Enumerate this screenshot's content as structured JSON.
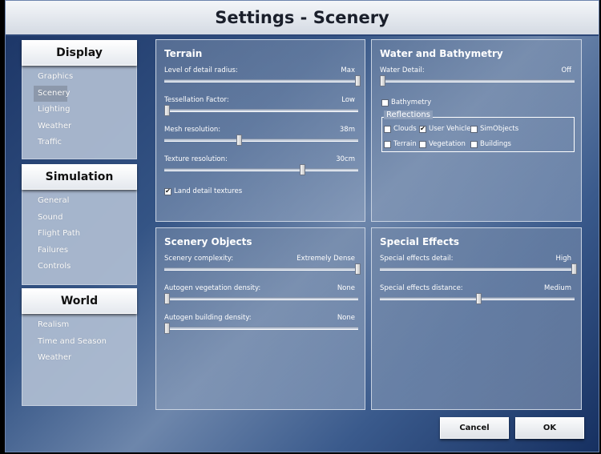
{
  "window": {
    "title": "Settings - Scenery"
  },
  "sidebar": {
    "sections": [
      {
        "header": "Display",
        "items": [
          "Graphics",
          "Scenery",
          "Lighting",
          "Weather",
          "Traffic"
        ],
        "selected": "Scenery"
      },
      {
        "header": "Simulation",
        "items": [
          "General",
          "Sound",
          "Flight Path",
          "Failures",
          "Controls"
        ]
      },
      {
        "header": "World",
        "items": [
          "Realism",
          "Time and Season",
          "Weather"
        ]
      }
    ]
  },
  "terrain": {
    "title": "Terrain",
    "lod": {
      "label": "Level of detail radius:",
      "value": "Max",
      "level": 1.0
    },
    "tess": {
      "label": "Tessellation Factor:",
      "value": "Low",
      "level": 0.0
    },
    "mesh": {
      "label": "Mesh resolution:",
      "value": "38m",
      "level": 0.38
    },
    "texture": {
      "label": "Texture resolution:",
      "value": "30cm",
      "level": 0.71
    },
    "land_detail": {
      "label": "Land detail textures",
      "checked": true
    }
  },
  "water": {
    "title": "Water and Bathymetry",
    "detail": {
      "label": "Water Detail:",
      "value": "Off",
      "level": 0.0
    },
    "bathymetry": {
      "label": "Bathymetry",
      "checked": false
    },
    "reflections": {
      "title": "Reflections",
      "clouds": {
        "label": "Clouds",
        "checked": false
      },
      "user_vehicle": {
        "label": "User Vehicle",
        "checked": true
      },
      "simobjects": {
        "label": "SimObjects",
        "checked": false
      },
      "terrain": {
        "label": "Terrain",
        "checked": false
      },
      "vegetation": {
        "label": "Vegetation",
        "checked": false
      },
      "buildings": {
        "label": "Buildings",
        "checked": false
      }
    }
  },
  "objects": {
    "title": "Scenery Objects",
    "complexity": {
      "label": "Scenery complexity:",
      "value": "Extremely Dense",
      "level": 1.0
    },
    "vegetation": {
      "label": "Autogen vegetation density:",
      "value": "None",
      "level": 0.0
    },
    "building": {
      "label": "Autogen building density:",
      "value": "None",
      "level": 0.0
    }
  },
  "effects": {
    "title": "Special Effects",
    "detail": {
      "label": "Special effects detail:",
      "value": "High",
      "level": 1.0
    },
    "distance": {
      "label": "Special effects distance:",
      "value": "Medium",
      "level": 0.5
    }
  },
  "buttons": {
    "cancel": "Cancel",
    "ok": "OK"
  },
  "check_mark": "✔"
}
